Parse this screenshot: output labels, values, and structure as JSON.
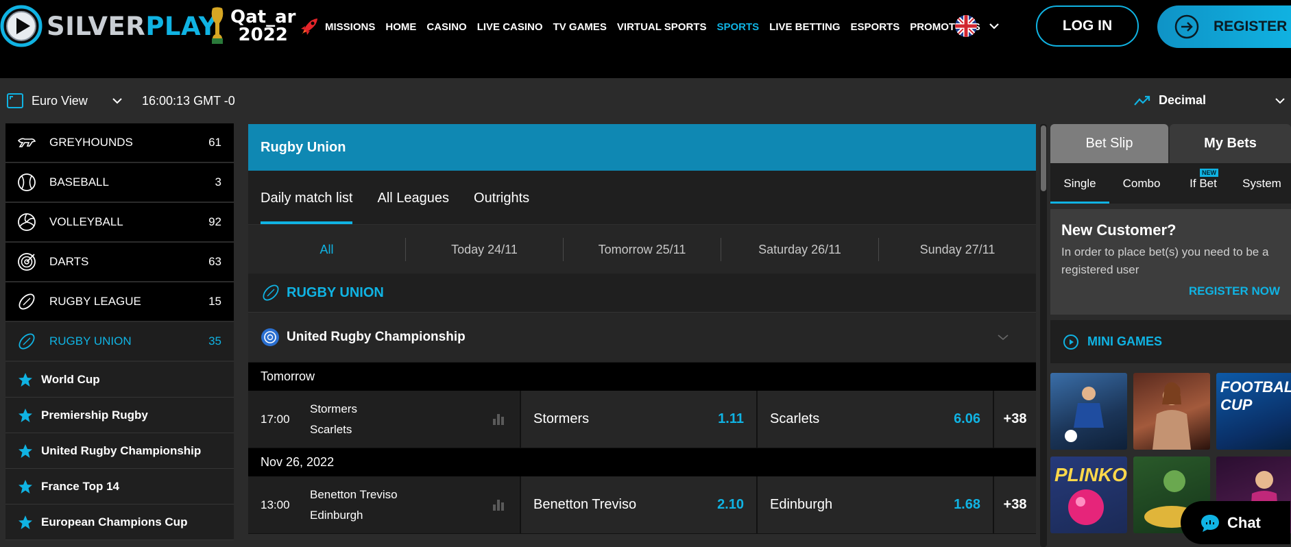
{
  "brand": {
    "silver": "SILVER",
    "play": "PLAY",
    "accent": "#10b3e3"
  },
  "qatar": {
    "line1": "Qat_ar",
    "line2": "2022"
  },
  "nav": {
    "items": [
      {
        "label": "MISSIONS",
        "active": false
      },
      {
        "label": "HOME",
        "active": false
      },
      {
        "label": "CASINO",
        "active": false
      },
      {
        "label": "LIVE CASINO",
        "active": false
      },
      {
        "label": "TV GAMES",
        "active": false
      },
      {
        "label": "VIRTUAL SPORTS",
        "active": false
      },
      {
        "label": "SPORTS",
        "active": true
      },
      {
        "label": "LIVE BETTING",
        "active": false
      },
      {
        "label": "ESPORTS",
        "active": false
      },
      {
        "label": "PROMOTIONS",
        "active": false
      }
    ]
  },
  "header": {
    "login": "LOG IN",
    "register": "REGISTER",
    "language_icon": "uk-flag-icon"
  },
  "subbar": {
    "view": "Euro View",
    "clock": "16:00:13 GMT -0",
    "odds_format": "Decimal"
  },
  "sidebar": {
    "sports": [
      {
        "name": "GREYHOUNDS",
        "count": "61",
        "icon": "greyhound-icon"
      },
      {
        "name": "BASEBALL",
        "count": "3",
        "icon": "baseball-icon"
      },
      {
        "name": "VOLLEYBALL",
        "count": "92",
        "icon": "volleyball-icon"
      },
      {
        "name": "DARTS",
        "count": "63",
        "icon": "darts-icon"
      },
      {
        "name": "RUGBY LEAGUE",
        "count": "15",
        "icon": "rugby-ball-icon"
      },
      {
        "name": "RUGBY UNION",
        "count": "35",
        "icon": "rugby-ball-icon"
      }
    ],
    "leagues": [
      "World Cup",
      "Premiership Rugby",
      "United Rugby Championship",
      "France Top 14",
      "European Champions Cup"
    ]
  },
  "main": {
    "title": "Rugby Union",
    "tabs": [
      "Daily match list",
      "All Leagues",
      "Outrights"
    ],
    "days": [
      "All",
      "Today 24/11",
      "Tomorrow 25/11",
      "Saturday 26/11",
      "Sunday 27/11"
    ],
    "section": "RUGBY UNION",
    "competition": "United Rugby Championship",
    "groups": [
      {
        "date": "Tomorrow",
        "match": {
          "time": "17:00",
          "home": "Stormers",
          "away": "Scarlets",
          "odd1_team": "Stormers",
          "odd1": "1.11",
          "odd2_team": "Scarlets",
          "odd2": "6.06",
          "more": "+38"
        }
      },
      {
        "date": "Nov 26, 2022",
        "match": {
          "time": "13:00",
          "home": "Benetton Treviso",
          "away": "Edinburgh",
          "odd1_team": "Benetton Treviso",
          "odd1": "2.10",
          "odd2_team": "Edinburgh",
          "odd2": "1.68",
          "more": "+38"
        }
      }
    ]
  },
  "betslip": {
    "tabs": [
      "Bet Slip",
      "My Bets"
    ],
    "types": [
      "Single",
      "Combo",
      "If Bet",
      "System"
    ],
    "new_badge": "NEW",
    "new_customer_title": "New Customer?",
    "new_customer_text": "In order to place bet(s) you need to be a registered user",
    "register_now": "REGISTER NOW",
    "mini_games": "MINI GAMES"
  },
  "thumbs": {
    "football_cup": "FOOTBALL CUP",
    "plinko": "PLINKO"
  },
  "chat": {
    "label": "Chat"
  }
}
